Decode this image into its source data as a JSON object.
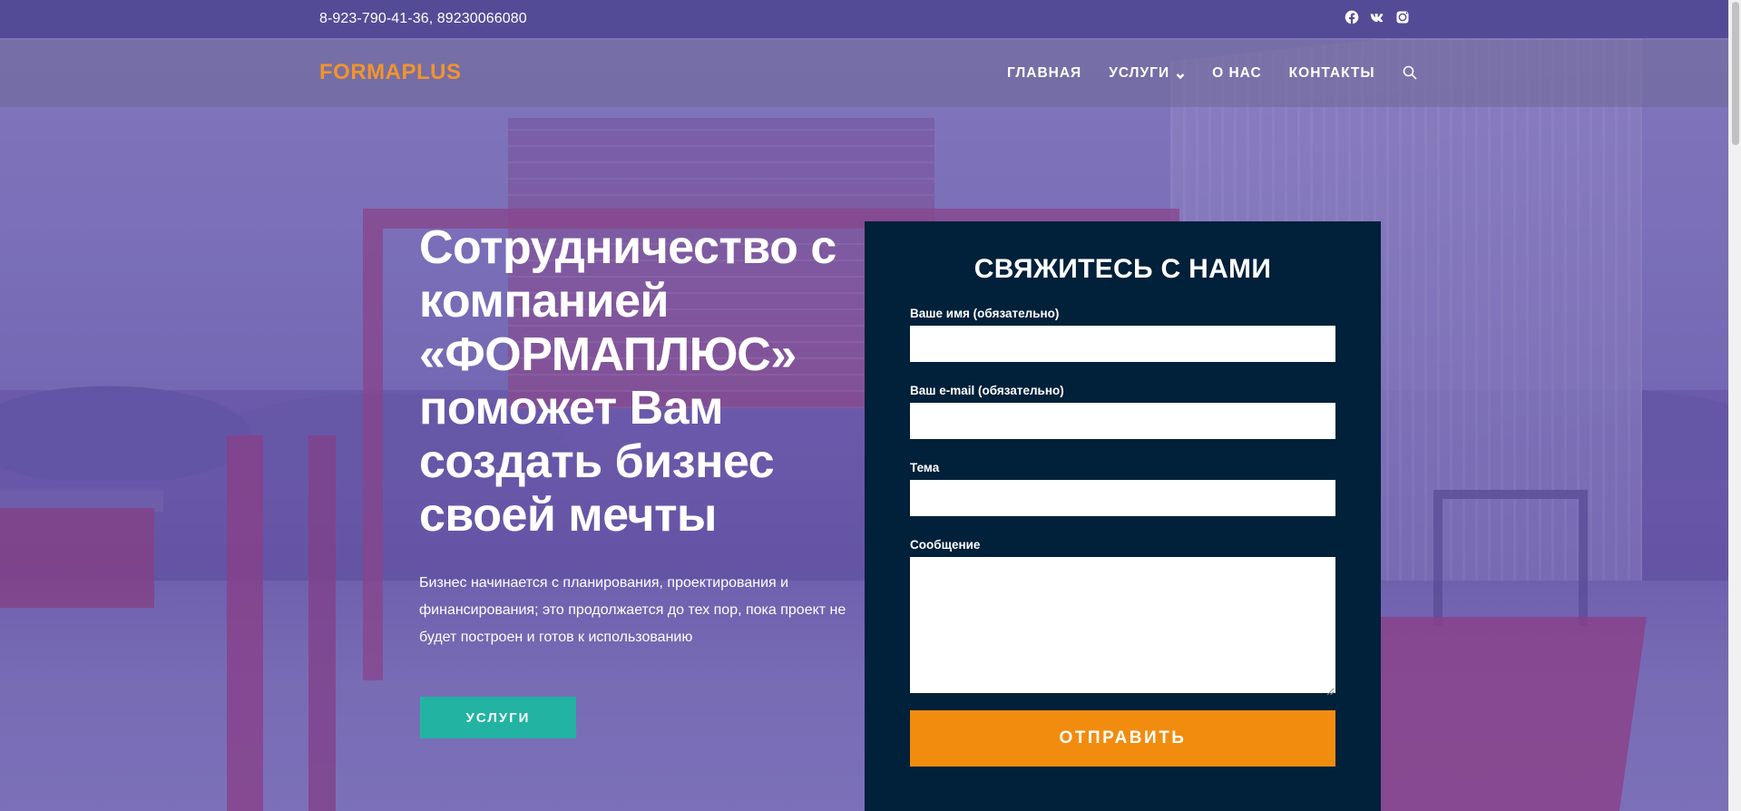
{
  "topbar": {
    "phone": "8-923-790-41-36, 89230066080",
    "social": [
      {
        "icon": "facebook-icon"
      },
      {
        "icon": "vk-icon"
      },
      {
        "icon": "instagram-icon"
      }
    ]
  },
  "header": {
    "logo": "FORMAPLUS",
    "nav": [
      {
        "label": "ГЛАВНАЯ"
      },
      {
        "label": "УСЛУГИ",
        "has_dropdown": true
      },
      {
        "label": "О НАС"
      },
      {
        "label": "КОНТАКТЫ"
      }
    ],
    "search_icon": "search-icon"
  },
  "hero": {
    "title": "Сотрудничество с компанией «ФОРМАПЛЮС» поможет Вам создать бизнес своей мечты",
    "description": "Бизнес начинается с планирования, проектирования и финансирования; это продолжается до тех пор, пока проект не будет построен и готов к использованию",
    "button": "УСЛУГИ"
  },
  "form": {
    "title": "СВЯЖИТЕСЬ С НАМИ",
    "fields": {
      "name_label": "Ваше имя (обязательно)",
      "name_value": "",
      "email_label": "Ваш e-mail (обязательно)",
      "email_value": "",
      "subject_label": "Тема",
      "subject_value": "",
      "message_label": "Сообщение",
      "message_value": ""
    },
    "submit": "ОТПРАВИТЬ"
  },
  "colors": {
    "topbar": "#544b97",
    "logo": "#f2942b",
    "hero_button": "#22b3a3",
    "form_panel": "#01203a",
    "submit_button": "#f28c0f"
  }
}
